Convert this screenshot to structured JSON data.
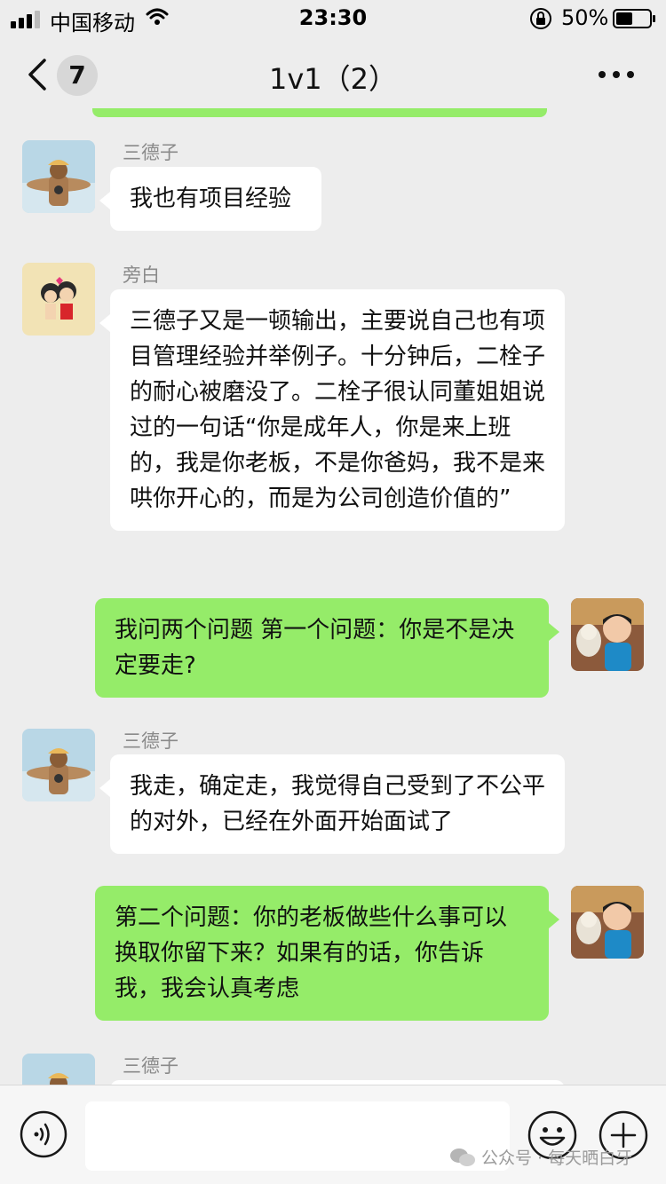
{
  "status_bar": {
    "carrier": "中国移动",
    "time": "23:30",
    "battery": "50%"
  },
  "nav": {
    "unread_count": "7",
    "title": "1v1（2）"
  },
  "messages": [
    {
      "sender": "三德子",
      "direction": "incoming",
      "text": "我也有项目经验"
    },
    {
      "sender": "旁白",
      "direction": "incoming",
      "text": "三德子又是一顿输出，主要说自己也有项目管理经验并举例子。十分钟后，二栓子的耐心被磨没了。二栓子很认同董姐姐说过的一句话“你是成年人，你是来上班的，我是你老板，不是你爸妈，我不是来哄你开心的，而是为公司创造价值的”"
    },
    {
      "sender": "",
      "direction": "outgoing",
      "text": "我问两个问题 第一个问题：你是不是决定要走?"
    },
    {
      "sender": "三德子",
      "direction": "incoming",
      "text": "我走，确定走，我觉得自己受到了不公平的对外，已经在外面开始面试了"
    },
    {
      "sender": "",
      "direction": "outgoing",
      "text": "第二个问题：你的老板做些什么事可以换取你留下来？如果有的话，你告诉我，我会认真考虑"
    },
    {
      "sender": "三德子",
      "direction": "incoming",
      "text": ""
    }
  ],
  "input": {
    "value": "",
    "placeholder": ""
  },
  "watermark": "公众号 · 每天晒白牙",
  "colors": {
    "background": "#ededed",
    "outgoing_bubble": "#95ec69",
    "incoming_bubble": "#ffffff",
    "sender_name": "#8a8a8a"
  }
}
